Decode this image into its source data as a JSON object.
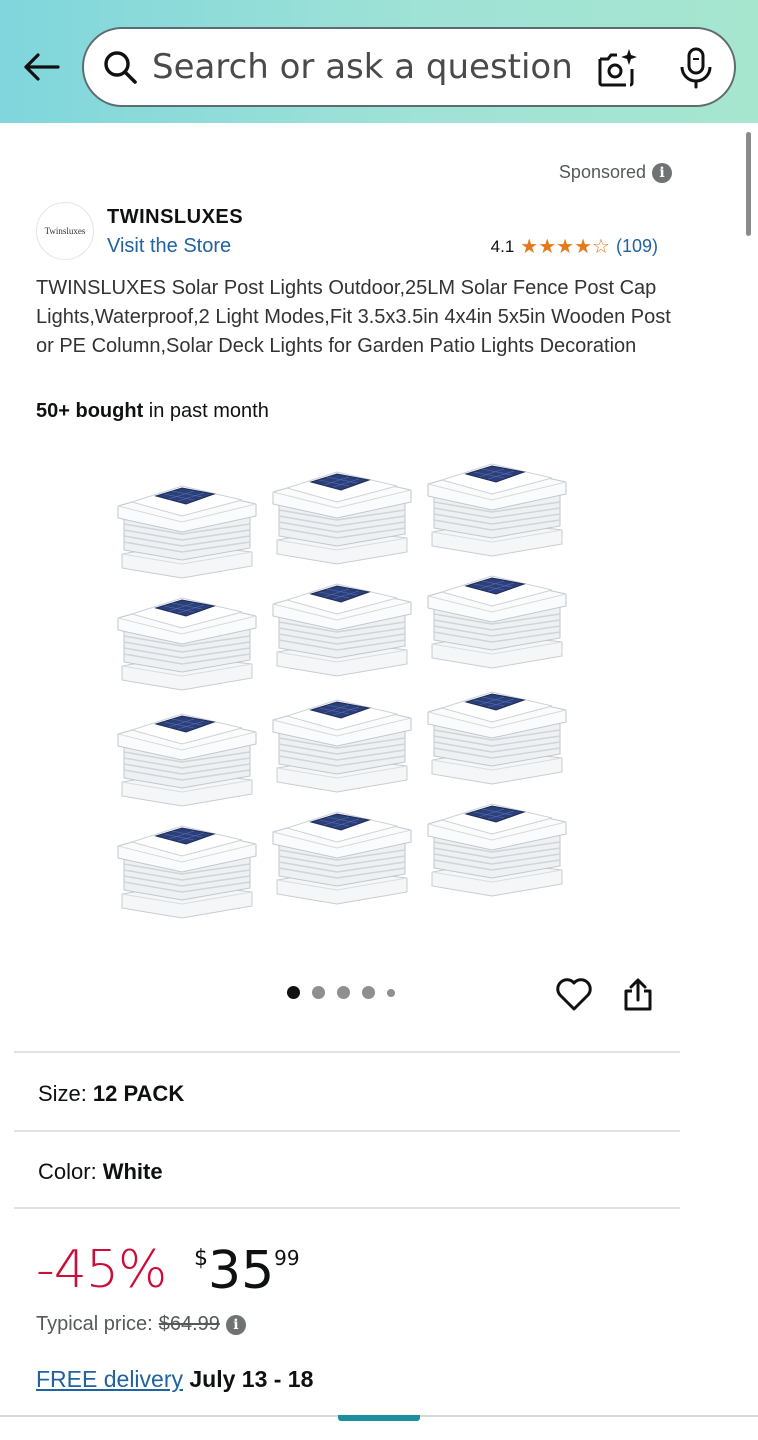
{
  "header": {
    "search_placeholder": "Search or ask a question",
    "back_icon": "arrow-left-icon",
    "search_icon": "magnifier-icon",
    "camera_icon": "camera-sparkle-icon",
    "mic_icon": "microphone-icon"
  },
  "sponsored": {
    "label": "Sponsored",
    "info_glyph": "i"
  },
  "brand": {
    "logo_text": "Twinsluxes",
    "name": "TWINSLUXES",
    "visit_store": "Visit the Store"
  },
  "rating": {
    "value": "4.1",
    "stars": 4,
    "star_max": 5,
    "count": "(109)"
  },
  "product": {
    "title": "TWINSLUXES Solar Post Lights Outdoor,25LM Solar Fence Post Cap Lights,Waterproof,2 Light Modes,Fit 3.5x3.5in 4x4in 5x5in Wooden Post or PE Column,Solar Deck Lights for Garden Patio Lights Decoration",
    "bought_bold": "50+ bought",
    "bought_rest": " in past month",
    "image_count": 5,
    "image_index": 1
  },
  "options": {
    "size_label": "Size:",
    "size_value": "12 PACK",
    "color_label": "Color:",
    "color_value": "White"
  },
  "price": {
    "discount": "-45%",
    "currency": "$",
    "whole": "35",
    "fraction": "99",
    "typical_label": "Typical price:",
    "typical_value": "$64.99",
    "info_glyph": "i"
  },
  "delivery": {
    "link": "FREE delivery",
    "dates": " July 13 - 18"
  },
  "colors": {
    "accent": "#2162a1",
    "deal": "#cc0c39",
    "star": "#e57a1b",
    "header_start": "#7fd6dc",
    "header_end": "#a6e6cf"
  }
}
